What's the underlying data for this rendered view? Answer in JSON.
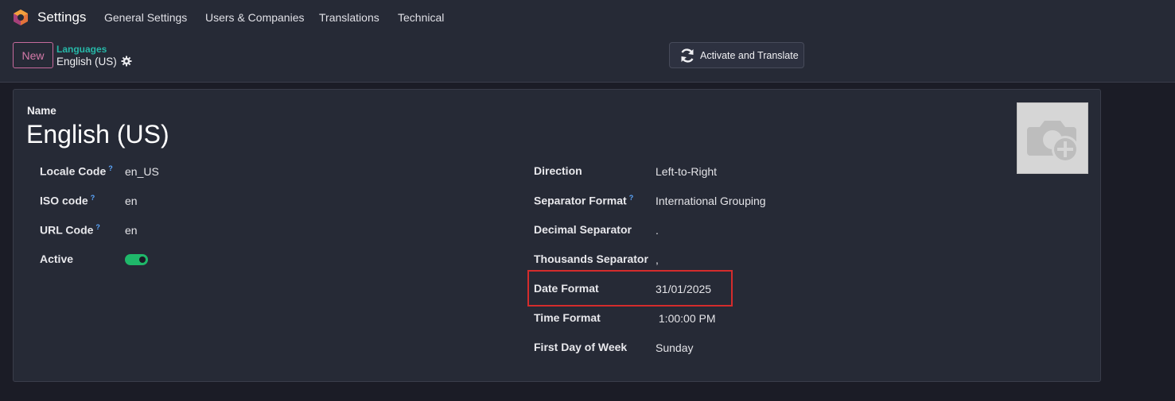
{
  "topbar": {
    "app_title": "Settings",
    "menu": [
      "General Settings",
      "Users & Companies",
      "Translations",
      "Technical"
    ]
  },
  "controlbar": {
    "new_label": "New",
    "breadcrumb_parent": "Languages",
    "breadcrumb_current": "English (US)",
    "activate_label": "Activate and Translate"
  },
  "form": {
    "name_label": "Name",
    "name_value": "English (US)",
    "left": [
      {
        "label": "Locale Code",
        "help": "?",
        "value": "en_US"
      },
      {
        "label": "ISO code",
        "help": "?",
        "value": "en"
      },
      {
        "label": "URL Code",
        "help": "?",
        "value": "en"
      },
      {
        "label": "Active",
        "value": ""
      }
    ],
    "active": true,
    "right": [
      {
        "label": "Direction",
        "value": "Left-to-Right"
      },
      {
        "label": "Separator Format",
        "help": "?",
        "value": "International Grouping"
      },
      {
        "label": "Decimal Separator",
        "value": "."
      },
      {
        "label": "Thousands Separator",
        "value": ","
      },
      {
        "label": "Date Format",
        "value": "31/01/2025"
      },
      {
        "label": "Time Format",
        "value": " 1:00:00 PM"
      },
      {
        "label": "First Day of Week",
        "value": "Sunday"
      }
    ]
  },
  "colors": {
    "background": "#1b1c26",
    "panel": "#262a36",
    "accent_teal": "#26b8a8",
    "new_button": "#d47aa9",
    "toggle_on": "#1fb86a",
    "highlight": "#d42c2c"
  },
  "icons": [
    "odoo-logo-icon",
    "gear-icon",
    "refresh-icon",
    "camera-add-icon",
    "help-icon"
  ]
}
